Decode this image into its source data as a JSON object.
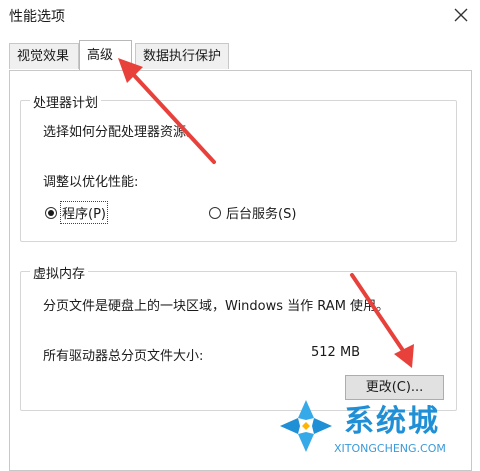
{
  "window": {
    "title": "性能选项"
  },
  "tabs": [
    {
      "label": "视觉效果"
    },
    {
      "label": "高级"
    },
    {
      "label": "数据执行保护"
    }
  ],
  "processor": {
    "legend": "处理器计划",
    "description": "选择如何分配处理器资源。",
    "adjust_label": "调整以优化性能:",
    "option_programs": "程序(P)",
    "option_services": "后台服务(S)",
    "selected": "程序(P)"
  },
  "virtual_memory": {
    "legend": "虚拟内存",
    "description": "分页文件是硬盘上的一块区域，Windows 当作 RAM 使用。",
    "total_label": "所有驱动器总分页文件大小:",
    "total_value": "512 MB",
    "change_button": "更改(C)..."
  },
  "watermark": {
    "cn": "系统城",
    "en": "XITONGCHENG.COM"
  },
  "colors": {
    "annotation_arrow": "#e8403a",
    "watermark_blue": "#1f8fd6"
  }
}
